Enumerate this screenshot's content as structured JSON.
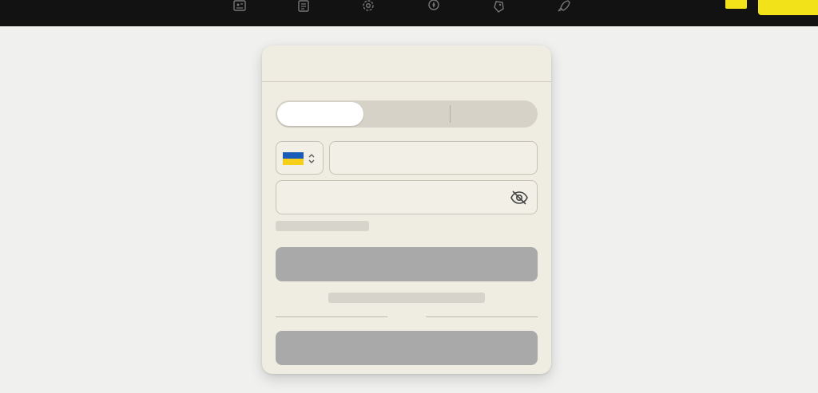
{
  "app": {
    "accent_color": "#f2e21a",
    "topbar_color": "#121212"
  },
  "topbar": {
    "icons": [
      {
        "name": "profile-card-icon"
      },
      {
        "name": "document-list-icon"
      },
      {
        "name": "settings-gear-icon"
      },
      {
        "name": "compass-icon"
      },
      {
        "name": "tag-icon"
      },
      {
        "name": "rocket-icon"
      }
    ]
  },
  "login_card": {
    "header_title": "",
    "tabs": [
      "",
      "",
      ""
    ],
    "active_tab_index": 0,
    "country_flag": "ukraine-flag",
    "phone_value": "",
    "phone_placeholder": "",
    "password_value": "",
    "password_placeholder": "",
    "hint_text": "",
    "primary_button_label": "",
    "link_text": "",
    "divider_text": "",
    "secondary_button_label": ""
  }
}
